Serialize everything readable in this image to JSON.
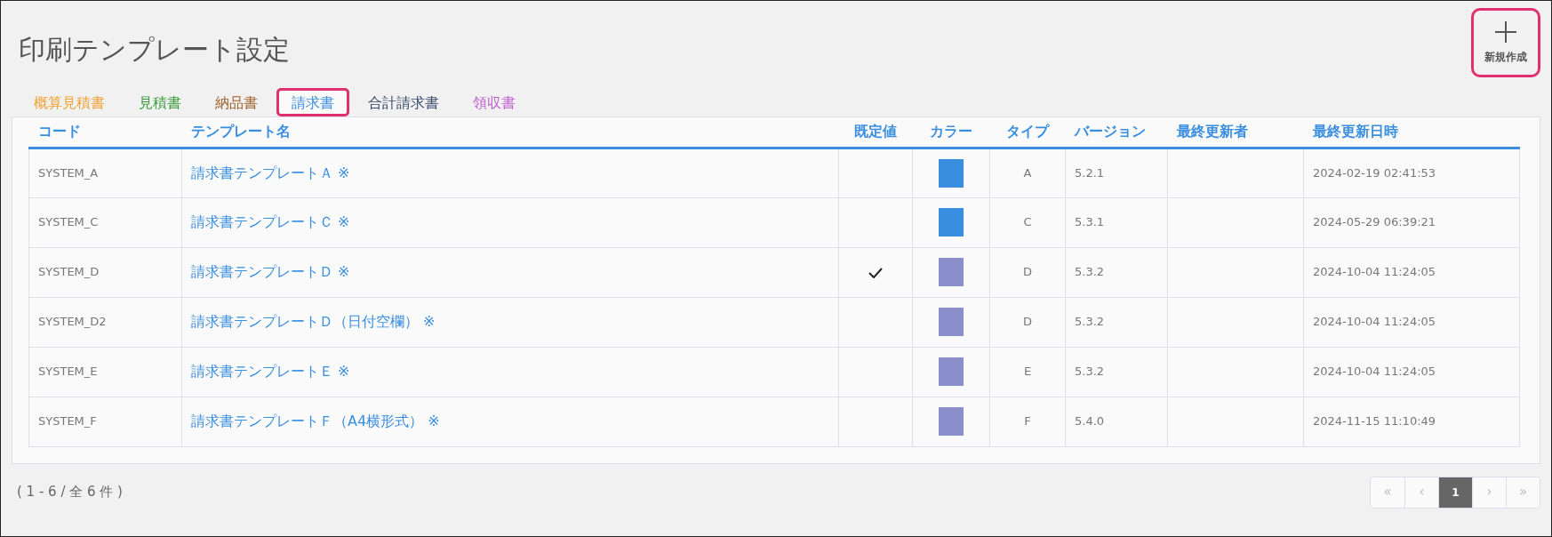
{
  "page_title": "印刷テンプレート設定",
  "new_button": {
    "label": "新規作成"
  },
  "tabs": [
    {
      "label": "概算見積書",
      "color": "#f0a030",
      "selected": false
    },
    {
      "label": "見積書",
      "color": "#3a9a3a",
      "selected": false
    },
    {
      "label": "納品書",
      "color": "#a0602a",
      "selected": false
    },
    {
      "label": "請求書",
      "color": "#3a8ee0",
      "selected": true
    },
    {
      "label": "合計請求書",
      "color": "#3a4a6a",
      "selected": false
    },
    {
      "label": "領収書",
      "color": "#c060d0",
      "selected": false
    }
  ],
  "table": {
    "columns": [
      "コード",
      "テンプレート名",
      "既定値",
      "カラー",
      "タイプ",
      "バージョン",
      "最終更新者",
      "最終更新日時"
    ],
    "rows": [
      {
        "code": "SYSTEM_A",
        "name": "請求書テンプレートＡ ※",
        "default": false,
        "color": "#3a8ee0",
        "type": "A",
        "version": "5.2.1",
        "updated": "2024-02-19 02:41:53"
      },
      {
        "code": "SYSTEM_C",
        "name": "請求書テンプレートＣ ※",
        "default": false,
        "color": "#3a8ee0",
        "type": "C",
        "version": "5.3.1",
        "updated": "2024-05-29 06:39:21"
      },
      {
        "code": "SYSTEM_D",
        "name": "請求書テンプレートＤ ※",
        "default": true,
        "color": "#8a8fcc",
        "type": "D",
        "version": "5.3.2",
        "updated": "2024-10-04 11:24:05"
      },
      {
        "code": "SYSTEM_D2",
        "name": "請求書テンプレートＤ（日付空欄） ※",
        "default": false,
        "color": "#8a8fcc",
        "type": "D",
        "version": "5.3.2",
        "updated": "2024-10-04 11:24:05"
      },
      {
        "code": "SYSTEM_E",
        "name": "請求書テンプレートＥ ※",
        "default": false,
        "color": "#8a8fcc",
        "type": "E",
        "version": "5.3.2",
        "updated": "2024-10-04 11:24:05"
      },
      {
        "code": "SYSTEM_F",
        "name": "請求書テンプレートＦ（A4横形式） ※",
        "default": false,
        "color": "#8a8fcc",
        "type": "F",
        "version": "5.4.0",
        "updated": "2024-11-15 11:10:49"
      }
    ]
  },
  "record_count": "( 1 - 6 / 全 6 件 )",
  "pagination": [
    {
      "label": "«",
      "selected": false,
      "disabled": true
    },
    {
      "label": "‹",
      "selected": false,
      "disabled": true
    },
    {
      "label": "1",
      "selected": true,
      "disabled": false
    },
    {
      "label": "›",
      "selected": false,
      "disabled": true
    },
    {
      "label": "»",
      "selected": false,
      "disabled": true
    }
  ]
}
